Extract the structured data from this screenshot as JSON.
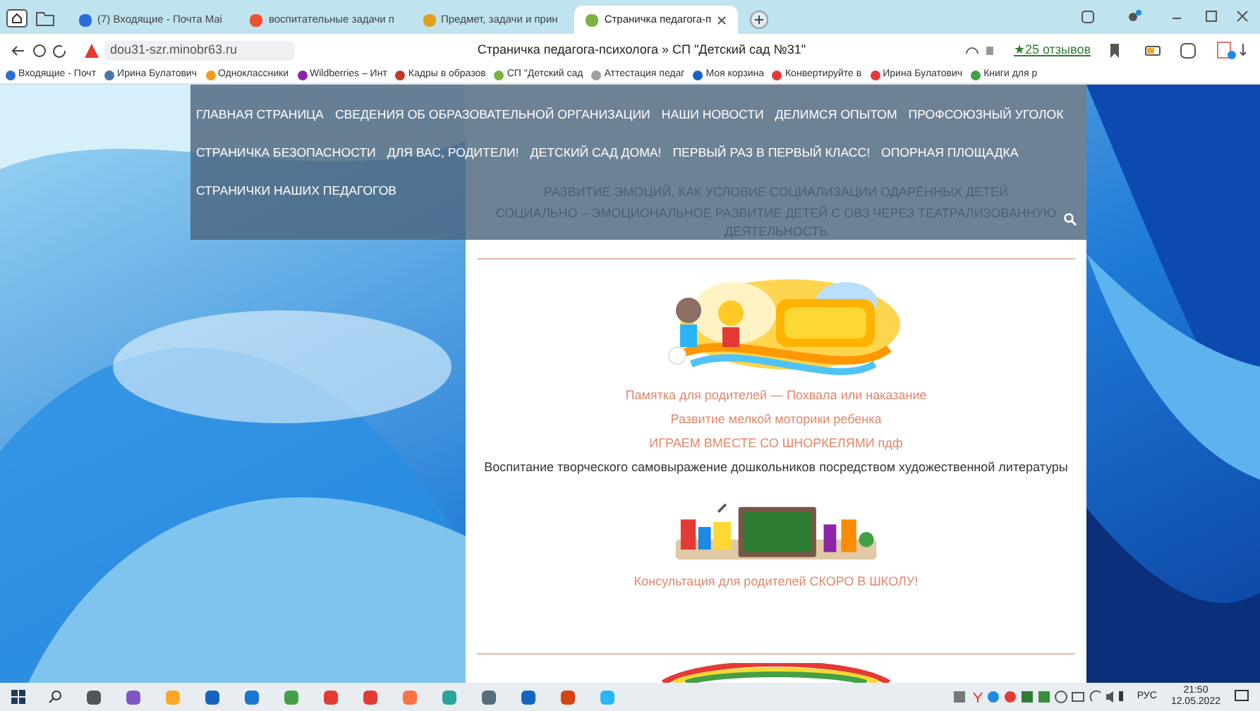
{
  "browser": {
    "tabs": [
      {
        "title": "(7) Входящие - Почта Mai",
        "selected": false,
        "color": "#2a6fd6"
      },
      {
        "title": "воспитательные задачи п",
        "selected": false,
        "color": "#f0502d"
      },
      {
        "title": "Предмет, задачи и прин",
        "selected": false,
        "color": "#e0a020"
      },
      {
        "title": "Страничка педагога-п",
        "selected": true,
        "color": "#7cb342"
      }
    ],
    "address": "dou31-szr.minobr63.ru",
    "page_title": "Страничка педагога-психолога » СП \"Детский сад №31\"",
    "reviews": "★25 отзывов",
    "bookmarks": [
      {
        "title": "Входящие - Почт",
        "color": "#2a6fd6"
      },
      {
        "title": "Ирина Булатович",
        "color": "#4a76a8"
      },
      {
        "title": "Одноклассники",
        "color": "#f59a23"
      },
      {
        "title": "Wildberries – Инт",
        "color": "#8e24aa"
      },
      {
        "title": "Кадры в образов",
        "color": "#c0392b"
      },
      {
        "title": "СП \"Детский сад",
        "color": "#7cb342"
      },
      {
        "title": "Аттестация педаг",
        "color": "#9e9e9e"
      },
      {
        "title": "Моя корзина",
        "color": "#1565c0"
      },
      {
        "title": "Конвертируйте в",
        "color": "#e53935"
      },
      {
        "title": "Ирина Булатович",
        "color": "#e53935"
      },
      {
        "title": "Книги для р",
        "color": "#43a047"
      }
    ]
  },
  "nav": {
    "items": [
      "ГЛАВНАЯ СТРАНИЦА",
      "СВЕДЕНИЯ ОБ ОБРАЗОВАТЕЛЬНОЙ ОРГАНИЗАЦИИ",
      "НАШИ НОВОСТИ",
      "ДЕЛИМСЯ ОПЫТОМ",
      "ПРОФСОЮЗНЫЙ УГОЛОК",
      "СТРАНИЧКА БЕЗОПАСНОСТИ",
      "ДЛЯ ВАС, РОДИТЕЛИ!",
      "ДЕТСКИЙ САД ДОМА!",
      "ПЕРВЫЙ РАЗ В ПЕРВЫЙ КЛАСС!",
      "ОПОРНАЯ ПЛОЩАДКА",
      "СТРАНИЧКИ НАШИХ ПЕДАГОГОВ"
    ]
  },
  "hidden_links": [
    "РАЗВИТИЕ ЭМОЦИЙ, КАК УСЛОВИЕ СОЦИАЛИЗАЦИИ ОДАРЁННЫХ ДЕТЕЙ",
    "СОЦИАЛЬНО – ЭМОЦИОНАЛЬНОЕ РАЗВИТИЕ ДЕТЕЙ С ОВЗ ЧЕРЕЗ ТЕАТРАЛИЗОВАННУЮ ДЕЯТЕЛЬНОСТЬ"
  ],
  "parents_section": {
    "kind": "picture",
    "items": [
      {
        "text": "Памятка для родителей — Похвала или наказание",
        "kind": "link"
      },
      {
        "text": "Развитие мелкой моторики ребенка",
        "kind": "link"
      },
      {
        "text": "ИГРАЕМ ВМЕСТЕ СО ШНОРКЕЛЯМИ пдф",
        "kind": "link"
      },
      {
        "text": "Воспитание творческого самовыражение дошкольников посредством художественной литературы",
        "kind": "text"
      }
    ]
  },
  "school_section": {
    "kind": "picture",
    "items": [
      {
        "text": "Консультация для родителей СКОРО В ШКОЛУ!",
        "kind": "link"
      }
    ]
  },
  "taskbar": {
    "language": "РУС",
    "time": "21:50",
    "date": "12.05.2022"
  }
}
